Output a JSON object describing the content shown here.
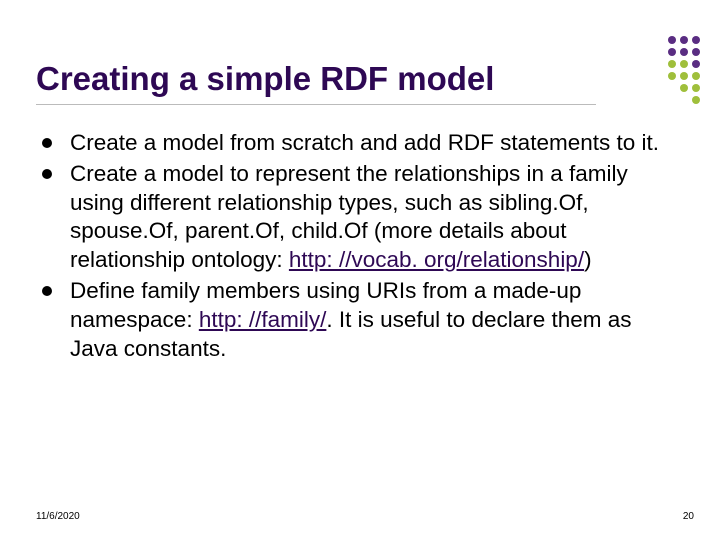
{
  "title": "Creating a simple RDF model",
  "bullets": [
    {
      "pre": "Create a model from scratch and add RDF statements to it.",
      "link": "",
      "post": ""
    },
    {
      "pre": "Create a model to represent the relationships in a family using different relationship types, such as sibling.Of, spouse.Of, parent.Of, child.Of (more details about relationship ontology: ",
      "link": "http: //vocab. org/relationship/",
      "post": ")"
    },
    {
      "pre": "Define family members using URIs from a made-up namespace: ",
      "link": "http: //family/",
      "post": ". It is useful to declare them as Java constants."
    }
  ],
  "footer": {
    "date": "11/6/2020",
    "page": "20"
  },
  "deco_colors": [
    "#fff",
    "#fff",
    "#fff",
    "#5a2d82",
    "#5a2d82",
    "#5a2d82",
    "#fff",
    "#fff",
    "#fff",
    "#5a2d82",
    "#5a2d82",
    "#5a2d82",
    "#fff",
    "#fff",
    "#fff",
    "#9fbf3b",
    "#9fbf3b",
    "#5a2d82",
    "#fff",
    "#fff",
    "#fff",
    "#9fbf3b",
    "#9fbf3b",
    "#9fbf3b",
    "#fff",
    "#fff",
    "#fff",
    "#fff",
    "#9fbf3b",
    "#9fbf3b",
    "#fff",
    "#fff",
    "#fff",
    "#fff",
    "#fff",
    "#9fbf3b"
  ]
}
